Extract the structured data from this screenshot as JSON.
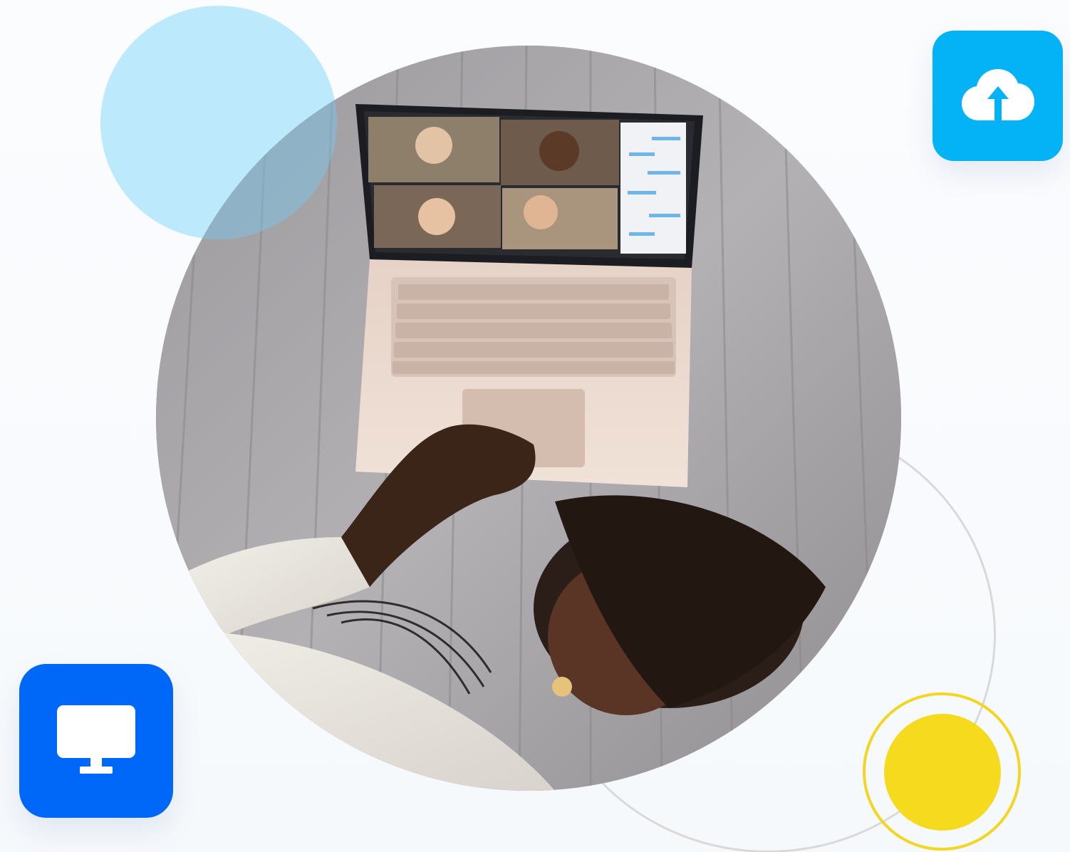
{
  "image": {
    "description_alt": "",
    "scene": "person-lying-on-bed-using-laptop-video-call"
  },
  "icons": {
    "cloud": {
      "name": "cloud-upload-icon",
      "tile_color": "#04b2f6",
      "glyph_color": "#ffffff"
    },
    "monitor": {
      "name": "monitor-icon",
      "tile_color": "#0068f9",
      "glyph_color": "#ffffff"
    }
  },
  "decor": {
    "light_blue": "#bde9fc",
    "yellow": "#f5da1e",
    "yellow_ring": "#f2d624",
    "gray_ring": "#d9d9d9"
  }
}
